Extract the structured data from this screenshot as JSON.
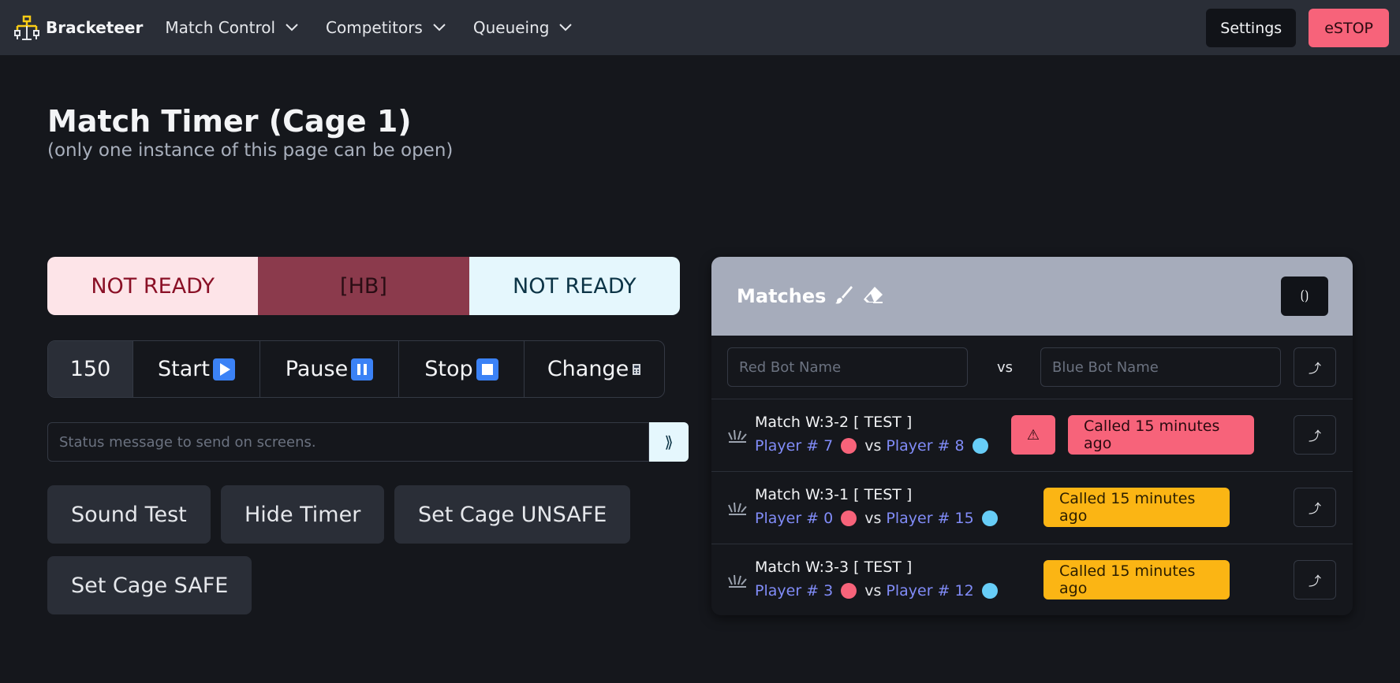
{
  "navbar": {
    "brand": "Bracketeer",
    "menus": [
      {
        "label": "Match Control"
      },
      {
        "label": "Competitors"
      },
      {
        "label": "Queueing"
      }
    ],
    "settings_label": "Settings",
    "estop_label": "eSTOP"
  },
  "page": {
    "title": "Match Timer (Cage 1)",
    "subtitle": "(only one instance of this page can be open)"
  },
  "status": {
    "red": "NOT READY",
    "middle": "[HB]",
    "blue": "NOT READY"
  },
  "controls": {
    "time": "150",
    "start": "Start",
    "pause": "Pause",
    "stop": "Stop",
    "change": "Change"
  },
  "message": {
    "placeholder": "Status message to send on screens.",
    "send_label": "⟫"
  },
  "actions": {
    "sound_test": "Sound Test",
    "hide_timer": "Hide Timer",
    "set_unsafe": "Set Cage UNSAFE",
    "set_safe": "Set Cage SAFE"
  },
  "matches": {
    "title": "Matches",
    "refresh_label": "⟮⟯",
    "new": {
      "red_placeholder": "Red Bot Name",
      "vs": "vs",
      "blue_placeholder": "Blue Bot Name",
      "go_label": "⤴"
    },
    "rows": [
      {
        "name": "Match W:3-2 [ TEST ]",
        "red": "Player # 7",
        "vs": "vs",
        "blue": "Player # 8",
        "warning": "⚠",
        "called": "Called 15 minutes ago",
        "go_label": "⤴"
      },
      {
        "name": "Match W:3-1 [ TEST ]",
        "red": "Player # 0",
        "vs": "vs",
        "blue": "Player # 15",
        "called": "Called 15 minutes ago",
        "go_label": "⤴"
      },
      {
        "name": "Match W:3-3 [ TEST ]",
        "red": "Player # 3",
        "vs": "vs",
        "blue": "Player # 12",
        "called": "Called 15 minutes ago",
        "go_label": "⤴"
      }
    ]
  },
  "colors": {
    "background": "#15171c",
    "navbar": "#2a2e37",
    "estop": "#f7637a",
    "red_status": "#fde4e8",
    "blue_status": "#e5f7fd",
    "warning": "#fbb514",
    "player_link": "#818cf8"
  }
}
